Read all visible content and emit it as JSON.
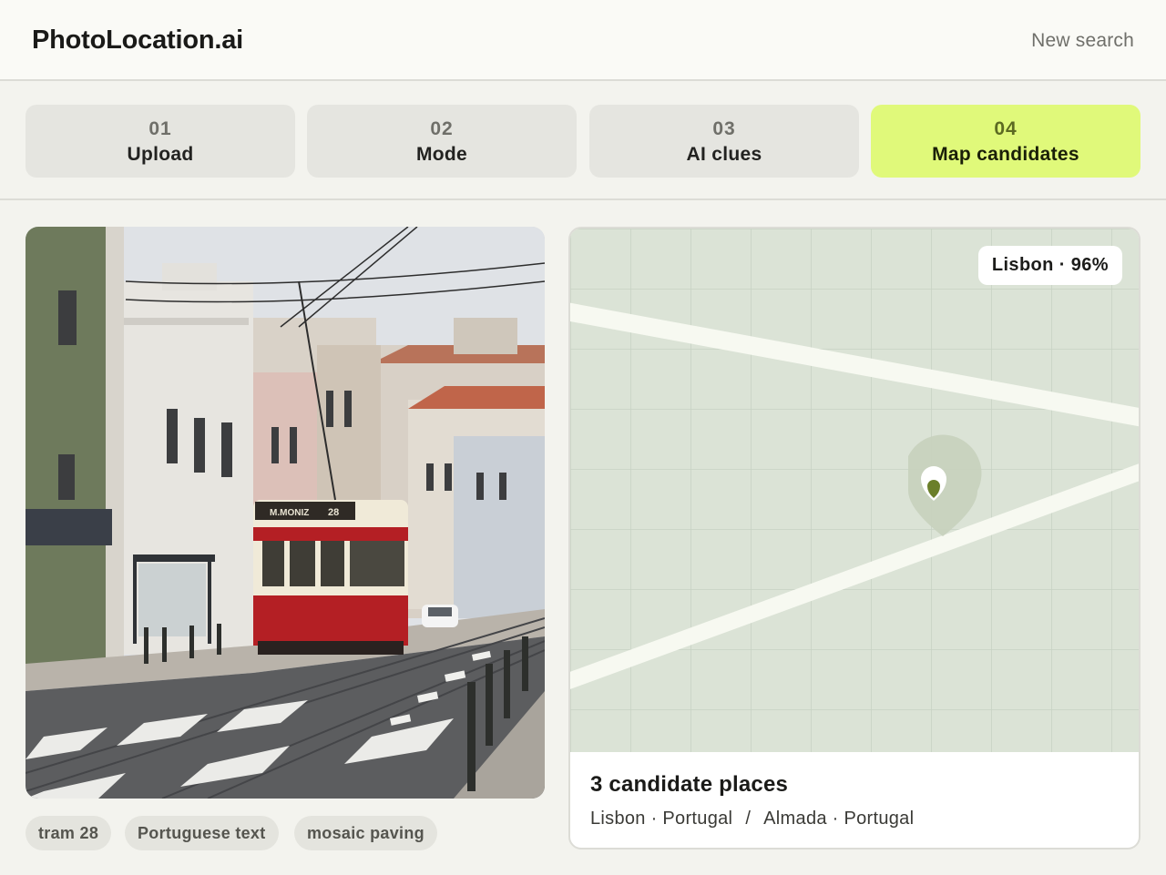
{
  "header": {
    "brand": "PhotoLocation.ai",
    "new_search_label": "New search"
  },
  "steps": [
    {
      "num": "01",
      "label": "Upload",
      "active": false
    },
    {
      "num": "02",
      "label": "Mode",
      "active": false
    },
    {
      "num": "03",
      "label": "AI clues",
      "active": false
    },
    {
      "num": "04",
      "label": "Map candidates",
      "active": true
    }
  ],
  "photo": {
    "tram_sign": "M.MONIZ",
    "tram_number": "28"
  },
  "clue_chips": [
    "tram 28",
    "Portuguese text",
    "mosaic paving"
  ],
  "map": {
    "badge": "Lisbon · 96%",
    "pin_icon": "map-pin-icon"
  },
  "candidates": {
    "title": "3 candidate places",
    "places": [
      "Lisbon · Portugal",
      "Almada · Portugal"
    ],
    "separator": "/"
  },
  "colors": {
    "accent": "#e0f97a",
    "map_background": "#dbe3d6",
    "pin": "#6b7f2a"
  }
}
